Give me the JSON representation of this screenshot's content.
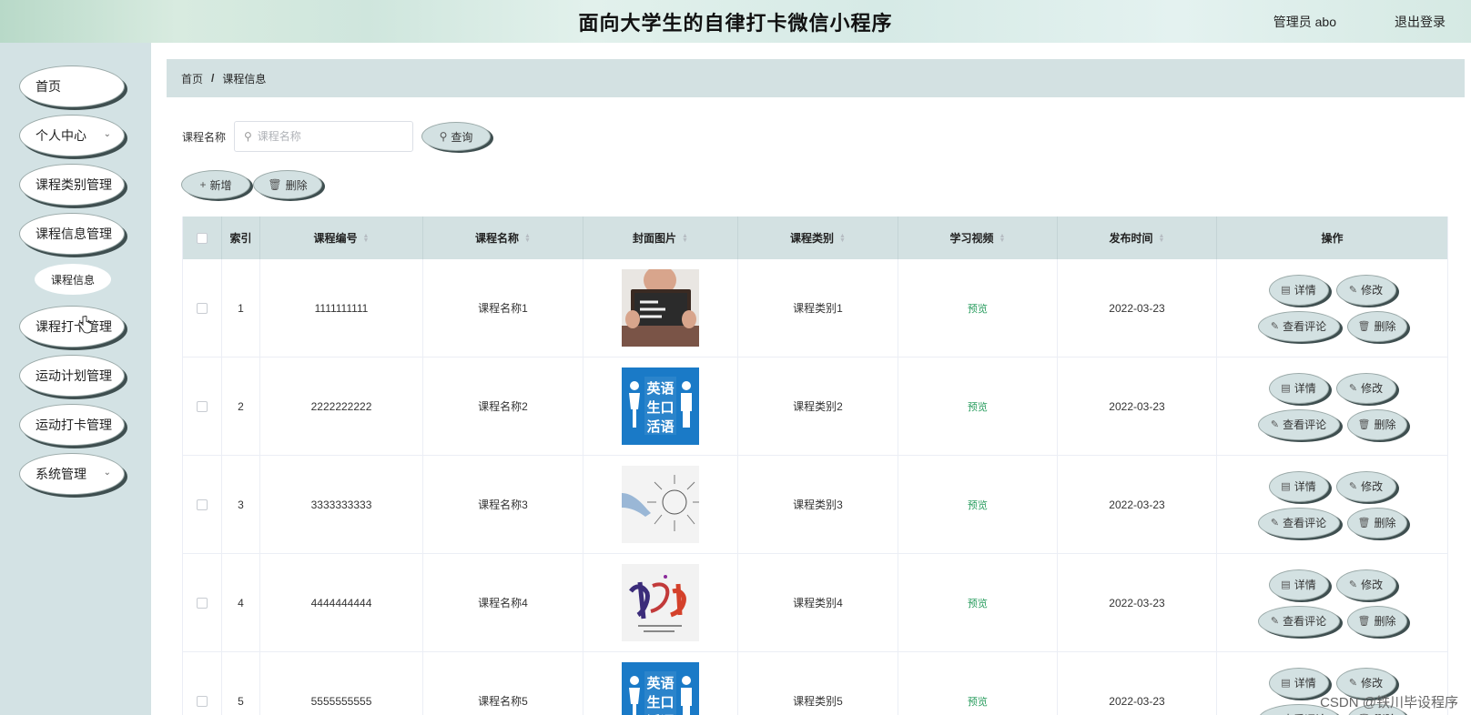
{
  "header": {
    "title": "面向大学生的自律打卡微信小程序",
    "user": "管理员 abo",
    "logout": "退出登录"
  },
  "sidebar": {
    "items": [
      {
        "label": "首页",
        "has_chevron": false
      },
      {
        "label": "个人中心",
        "has_chevron": true
      },
      {
        "label": "课程类别管理",
        "has_chevron": false
      },
      {
        "label": "课程信息管理",
        "has_chevron": false
      },
      {
        "label": "课程打卡管理",
        "has_chevron": false
      },
      {
        "label": "运动计划管理",
        "has_chevron": false
      },
      {
        "label": "运动打卡管理",
        "has_chevron": false
      },
      {
        "label": "系统管理",
        "has_chevron": true
      }
    ],
    "sub_item": "课程信息"
  },
  "breadcrumb": {
    "home": "首页",
    "separator": "/",
    "current": "课程信息"
  },
  "search": {
    "label": "课程名称",
    "placeholder": "课程名称",
    "button": "查询"
  },
  "toolbar": {
    "add": "新增",
    "delete": "删除"
  },
  "table": {
    "columns": [
      "索引",
      "课程编号",
      "课程名称",
      "封面图片",
      "课程类别",
      "学习视频",
      "发布时间",
      "操作"
    ],
    "rows": [
      {
        "index": "1",
        "code": "1111111111",
        "name": "课程名称1",
        "image": "do-you-speak-english-sign",
        "category": "课程类别1",
        "video": "预览",
        "date": "2022-03-23"
      },
      {
        "index": "2",
        "code": "2222222222",
        "name": "课程名称2",
        "image": "english-oral-blue-poster",
        "category": "课程类别2",
        "video": "预览",
        "date": "2022-03-23"
      },
      {
        "index": "3",
        "code": "3333333333",
        "name": "课程名称3",
        "image": "business-training-sketch",
        "category": "课程类别3",
        "video": "预览",
        "date": "2022-03-23"
      },
      {
        "index": "4",
        "code": "4444444444",
        "name": "课程名称4",
        "image": "calligraphy-poster",
        "category": "课程类别4",
        "video": "预览",
        "date": "2022-03-23"
      },
      {
        "index": "5",
        "code": "5555555555",
        "name": "课程名称5",
        "image": "english-oral-blue-poster",
        "category": "课程类别5",
        "video": "预览",
        "date": "2022-03-23"
      }
    ],
    "actions": {
      "detail": "详情",
      "edit": "修改",
      "comments": "查看评论",
      "delete": "删除"
    },
    "poster_text": {
      "line1": "英语",
      "line2": "生口",
      "line3": "活语"
    }
  },
  "watermark": "CSDN @铁川毕设程序",
  "colors": {
    "sidebar_bg": "#d3e2e4",
    "button_bg": "#d3e1e2",
    "button_shadow": "#3f4f50",
    "preview_green": "#2a9d5f",
    "poster_blue": "#1a7ac7"
  }
}
